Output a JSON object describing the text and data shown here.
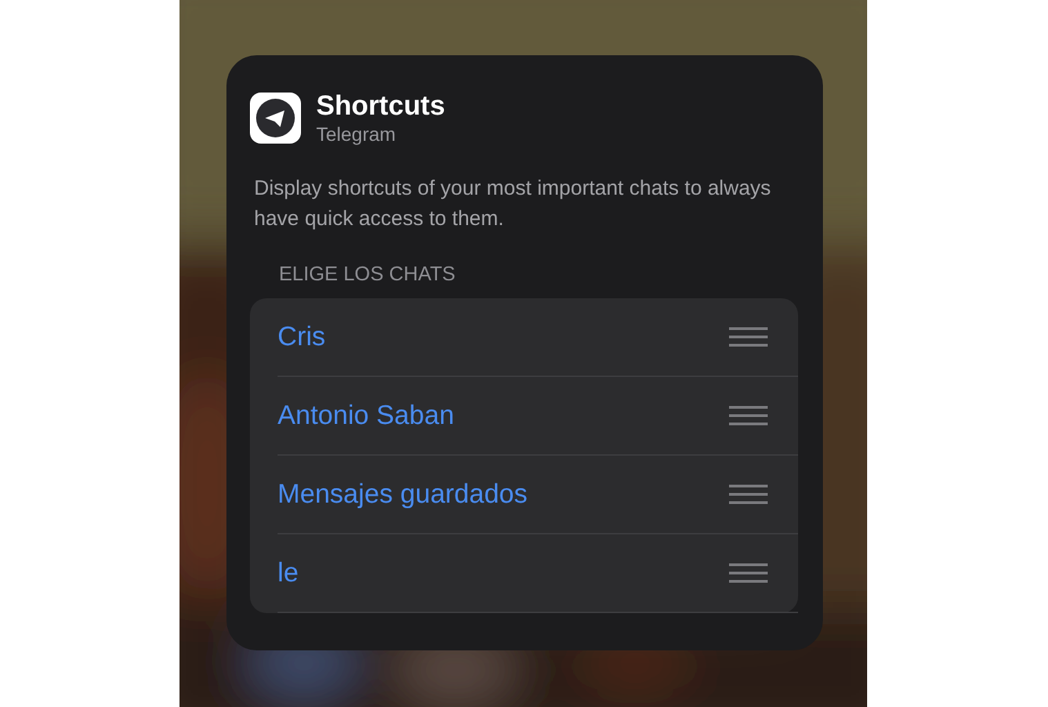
{
  "widget": {
    "title": "Shortcuts",
    "subtitle": "Telegram",
    "description": "Display shortcuts of your most important chats to always have quick access to them."
  },
  "section": {
    "header": "ELIGE LOS CHATS"
  },
  "chats": [
    {
      "name": "Cris"
    },
    {
      "name": "Antonio Saban"
    },
    {
      "name": "Mensajes guardados"
    },
    {
      "name": "le"
    }
  ]
}
